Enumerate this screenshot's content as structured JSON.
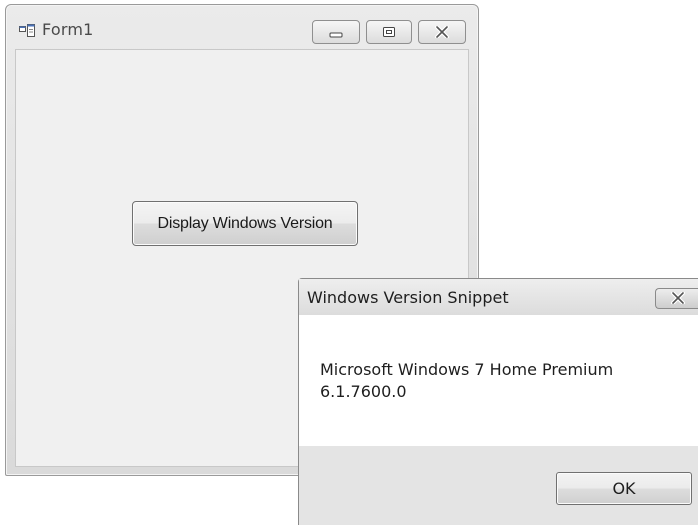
{
  "main_window": {
    "title": "Form1",
    "icon": "form-icon",
    "controls": [
      "minimize-icon",
      "maximize-icon",
      "close-icon"
    ],
    "button_label": "Display Windows Version"
  },
  "message_box": {
    "title": "Windows Version Snippet",
    "close_icon": "close-icon",
    "message_lines": [
      "Microsoft Windows 7 Home Premium",
      "6.1.7600.0"
    ],
    "ok_label": "OK"
  }
}
